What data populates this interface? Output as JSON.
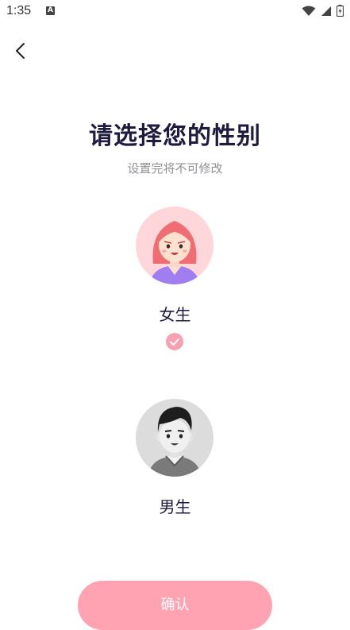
{
  "status_bar": {
    "time": "1:35",
    "notification_letter": "A"
  },
  "header": {
    "title": "请选择您的性别",
    "subtitle": "设置完将不可修改"
  },
  "genders": [
    {
      "label": "女生",
      "selected": true
    },
    {
      "label": "男生",
      "selected": false
    }
  ],
  "footer": {
    "confirm_label": "确认"
  },
  "colors": {
    "accent": "#ffa3b3",
    "check": "#f9a0b3",
    "title": "#1e1b3f",
    "subtitle": "#8f8f96"
  }
}
